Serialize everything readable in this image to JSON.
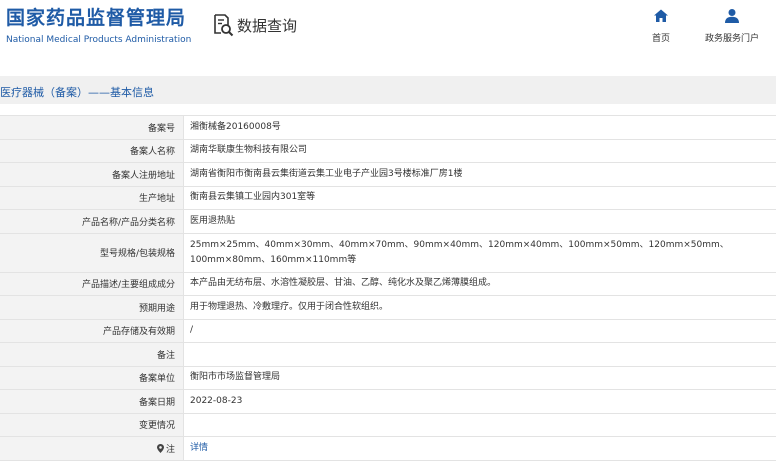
{
  "header": {
    "logo_cn": "国家药品监督管理局",
    "logo_en": "National Medical Products Administration",
    "query_label": "数据查询",
    "nav": [
      {
        "label": "首页",
        "icon": "home-icon"
      },
      {
        "label": "政务服务门户",
        "icon": "user-icon"
      }
    ]
  },
  "band": {
    "title": "医疗器械（备案）——基本信息"
  },
  "colors": {
    "brand": "#1f5ba6",
    "label_bg": "#f3f3f3",
    "border": "#e3e3e3"
  },
  "rows": [
    {
      "label": "备案号",
      "value": "湘衡械备20160008号"
    },
    {
      "label": "备案人名称",
      "value": "湖南华联康生物科技有限公司"
    },
    {
      "label": "备案人注册地址",
      "value": "湖南省衡阳市衡南县云集街道云集工业电子产业园3号楼标准厂房1楼"
    },
    {
      "label": "生产地址",
      "value": "衡南县云集镇工业园内301室等"
    },
    {
      "label": "产品名称/产品分类名称",
      "value": "医用退热贴"
    },
    {
      "label": "型号规格/包装规格",
      "value": "25mm×25mm、40mm×30mm、40mm×70mm、90mm×40mm、120mm×40mm、100mm×50mm、120mm×50mm、100mm×80mm、160mm×110mm等"
    },
    {
      "label": "产品描述/主要组成成分",
      "value": "本产品由无纺布层、水溶性凝胶层、甘油、乙醇、纯化水及聚乙烯薄膜组成。"
    },
    {
      "label": "预期用途",
      "value": "用于物理退热、冷敷理疗。仅用于闭合性软组织。"
    },
    {
      "label": "产品存储及有效期",
      "value": "/"
    },
    {
      "label": "备注",
      "value": ""
    },
    {
      "label": "备案单位",
      "value": "衡阳市市场监督管理局"
    },
    {
      "label": "备案日期",
      "value": "2022-08-23"
    },
    {
      "label": "变更情况",
      "value": ""
    },
    {
      "label": "注",
      "value": "详情"
    }
  ]
}
